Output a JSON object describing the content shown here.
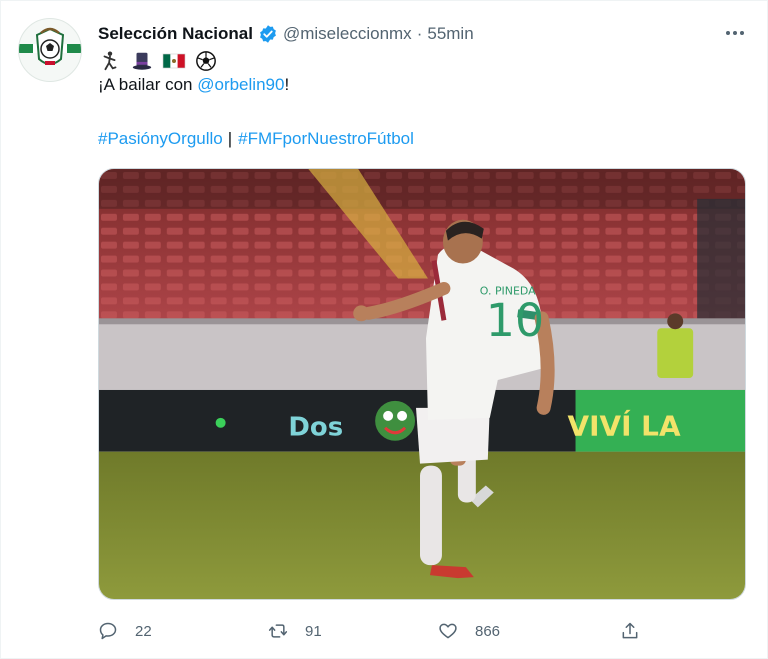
{
  "tweet": {
    "author_name": "Selección Nacional",
    "author_handle": "@miseleccionmx",
    "separator": "·",
    "timestamp": "55min",
    "emojis": [
      "dancer-emoji",
      "top-hat-emoji",
      "mexico-flag-emoji",
      "soccer-ball-emoji"
    ],
    "text_prefix": "¡A bailar con ",
    "mention": "@orbelin90",
    "text_suffix": "!",
    "hashtag_1": "#PasiónyOrgullo",
    "hashtag_separator": "|",
    "hashtag_2": "#FMFporNuestroFútbol",
    "media": {
      "jersey_name": "O. PINEDA",
      "jersey_number": "10",
      "board_left_text": "Dos",
      "board_right_text": "VIVÍ LA"
    }
  },
  "actions": {
    "reply_count": "22",
    "retweet_count": "91",
    "like_count": "866"
  },
  "colors": {
    "link": "#1d9bf0",
    "secondary_text": "#536471",
    "verified_badge": "#1d9bf0"
  }
}
